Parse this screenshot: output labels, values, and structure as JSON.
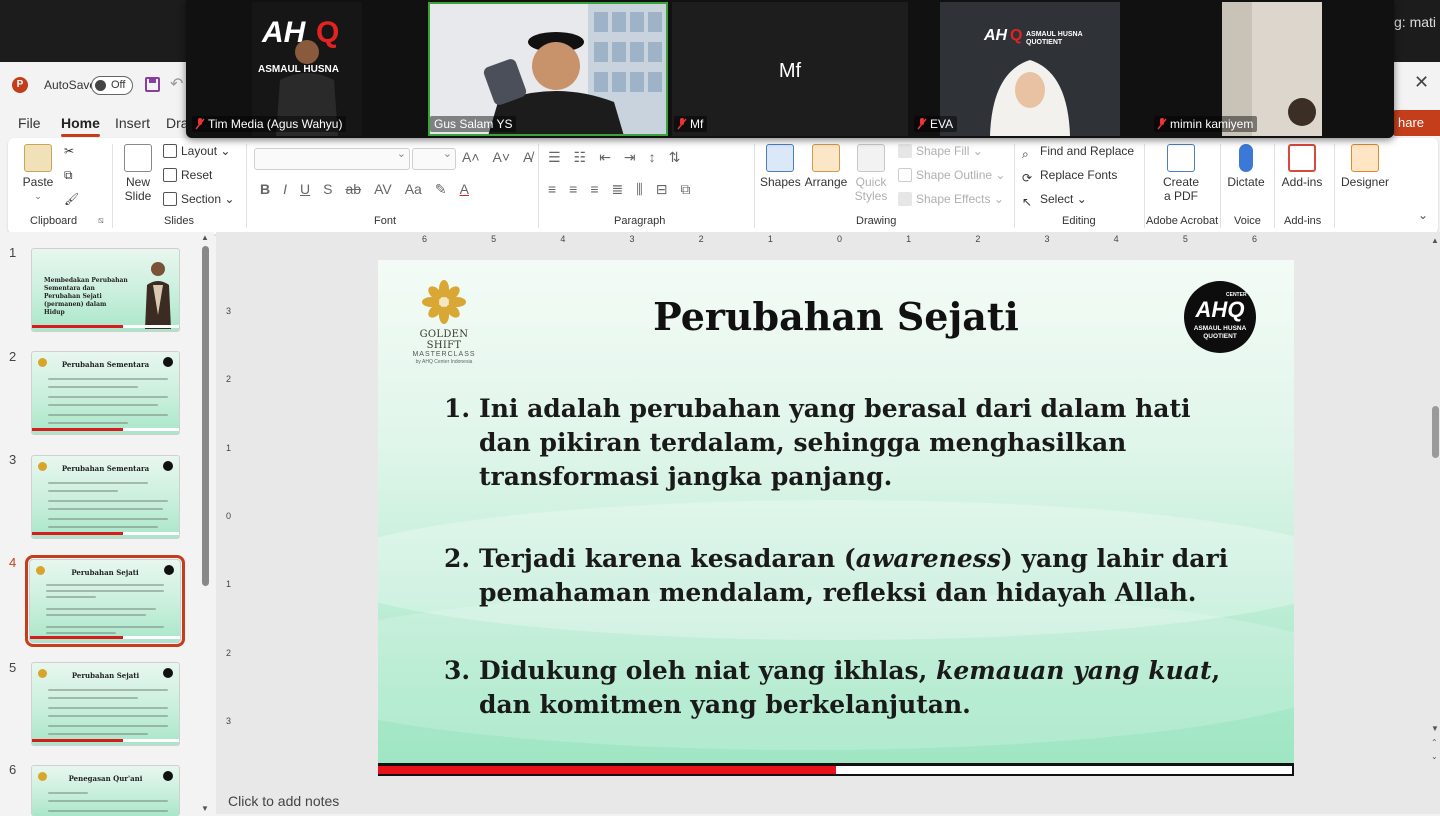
{
  "app": {
    "autosave_label": "AutoSave",
    "autosave_state": "Off",
    "close_glyph": "✕",
    "share_label": "hare",
    "accent_color": "#c43e1c"
  },
  "tabs": [
    {
      "label": "File"
    },
    {
      "label": "Home",
      "active": true
    },
    {
      "label": "Insert"
    },
    {
      "label": "Dra"
    }
  ],
  "ribbon": {
    "clipboard": {
      "group": "Clipboard",
      "paste": "Paste"
    },
    "slides": {
      "group": "Slides",
      "new_slide": "New\nSlide",
      "layout": "Layout",
      "reset": "Reset",
      "section": "Section"
    },
    "font": {
      "group": "Font"
    },
    "paragraph": {
      "group": "Paragraph"
    },
    "drawing": {
      "group": "Drawing",
      "shapes": "Shapes",
      "arrange": "Arrange",
      "quick_styles": "Quick\nStyles",
      "shape_fill": "Shape Fill",
      "shape_outline": "Shape Outline",
      "shape_effects": "Shape Effects"
    },
    "editing": {
      "group": "Editing",
      "find_replace": "Find and Replace",
      "replace_fonts": "Replace Fonts",
      "select": "Select"
    },
    "acrobat": {
      "group": "Adobe Acrobat",
      "create_pdf": "Create\na PDF"
    },
    "voice": {
      "group": "Voice",
      "dictate": "Dictate"
    },
    "addins": {
      "group": "Add-ins",
      "addins": "Add-ins"
    },
    "designer": {
      "designer": "Designer"
    }
  },
  "thumbnails": [
    {
      "num": "1",
      "title": "",
      "body_title": "Membedakan Perubahan Sementara dan Perubahan Sejati (permanen) dalam Hidup"
    },
    {
      "num": "2",
      "title": "Perubahan Sementara"
    },
    {
      "num": "3",
      "title": "Perubahan Sementara"
    },
    {
      "num": "4",
      "title": "Perubahan Sejati",
      "active": true
    },
    {
      "num": "5",
      "title": "Perubahan Sejati"
    },
    {
      "num": "6",
      "title": "Penegasan Qur'ani"
    }
  ],
  "ruler": {
    "h_ticks": [
      "6",
      "5",
      "4",
      "3",
      "2",
      "1",
      "0",
      "1",
      "2",
      "3",
      "4",
      "5",
      "6"
    ],
    "v_ticks": [
      "3",
      "2",
      "1",
      "0",
      "1",
      "2",
      "3"
    ]
  },
  "slide": {
    "title": "Perubahan Sejati",
    "brand_name": "GOLDEN SHIFT",
    "brand_sub": "MASTERCLASS",
    "brand_tag": "by AHQ Center Indonesia",
    "ahq_big": "AHQ",
    "ahq_center": "CENTER",
    "ahq_line1": "ASMAUL HUSNA",
    "ahq_line2": "QUOTIENT",
    "items": [
      {
        "num": "1.",
        "text": "Ini adalah perubahan yang berasal dari dalam hati dan pikiran terdalam, sehingga menghasilkan transformasi jangka panjang."
      },
      {
        "num": "2.",
        "pre": "Terjadi karena kesadaran (",
        "em": "awareness",
        "post": ") yang lahir dari pemahaman mendalam, refleksi dan hidayah Allah."
      },
      {
        "num": "3.",
        "pre": "Didukung oleh niat yang ikhlas, ",
        "em": "kemauan yang kuat",
        "post": ", dan komitmen yang berkelanjutan."
      }
    ],
    "progress": 0.5
  },
  "notes_placeholder": "Click to add notes",
  "meeting": {
    "top_right": "g: mati",
    "participants": [
      {
        "name": "Tim Media (Agus Wahyu)",
        "muted": true
      },
      {
        "name": "Gus Salam YS",
        "muted": false,
        "active": true
      },
      {
        "name": "Mf",
        "muted": true,
        "display": "Mf"
      },
      {
        "name": "EVA",
        "muted": true
      },
      {
        "name": "mimin kamiyem",
        "muted": true
      }
    ]
  }
}
